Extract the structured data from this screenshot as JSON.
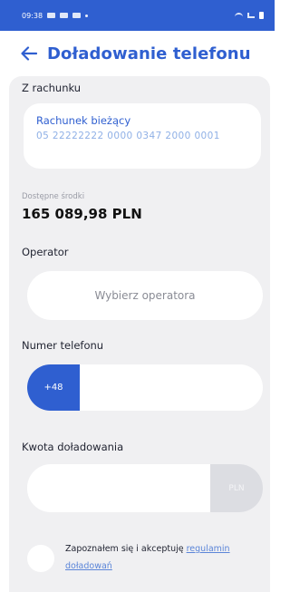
{
  "status_bar": {
    "time": "09:38"
  },
  "header": {
    "title": "Doładowanie telefonu",
    "back_icon": "arrow-left-icon"
  },
  "colors": {
    "brand": "#2f5fd0",
    "card_bg": "#f0f0f2",
    "link": "#5b85d8"
  },
  "source_account": {
    "label": "Z rachunku",
    "name": "Rachunek bieżący",
    "number": "05 22222222 0000 0347 2000 0001"
  },
  "available_funds": {
    "label": "Dostępne środki",
    "value": "165 089,98 PLN"
  },
  "operator": {
    "label": "Operator",
    "placeholder": "Wybierz operatora"
  },
  "phone": {
    "label": "Numer telefonu",
    "prefix": "+48",
    "value": ""
  },
  "amount": {
    "label": "Kwota doładowania",
    "currency": "PLN",
    "value": ""
  },
  "consent": {
    "text": "Zapoznałem się i akceptuję ",
    "link": "regulamin doładowań",
    "checked": false
  }
}
